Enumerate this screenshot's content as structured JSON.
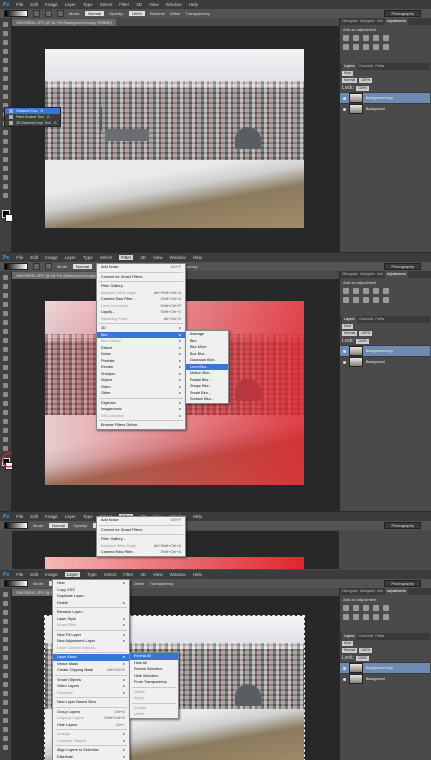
{
  "app": {
    "logo": "Ps",
    "menus": [
      "File",
      "Edit",
      "Image",
      "Layer",
      "Type",
      "Select",
      "Filter",
      "3D",
      "View",
      "Window",
      "Help"
    ],
    "workspace": "Photography"
  },
  "options_bar": {
    "mode_label": "Mode:",
    "mode_value": "Normal",
    "opacity_label": "Opacity:",
    "opacity_value": "100%",
    "reverse": "Reverse",
    "dither": "Dither",
    "transparency": "Transparency"
  },
  "document_tab": "ZNKS5931.JPG @ 16,7% (Background copy, RGB/8*)",
  "panels": {
    "tabs": [
      "Histogram",
      "Navigator",
      "Info",
      "Adjustments"
    ],
    "adjustments_title": "Add an adjustment",
    "layer_tabs": [
      "Layers",
      "Channels",
      "Paths"
    ],
    "kind_label": "Kind",
    "blend_mode": "Normal",
    "opacity_value": "100%",
    "lock_label": "Lock:",
    "fill_value": "100%",
    "layers": [
      {
        "name": "Background copy"
      },
      {
        "name": "Background"
      }
    ]
  },
  "tools_flyout": {
    "items": [
      {
        "label": "Gradient Tool",
        "key": "G",
        "highlighted": true
      },
      {
        "label": "Paint Bucket Tool",
        "key": "G",
        "highlighted": false
      },
      {
        "label": "3D Material Drop Tool",
        "key": "G",
        "highlighted": false
      }
    ]
  },
  "filter_menu": {
    "items": [
      {
        "label": "Add Noise",
        "shortcut": "Ctrl+F",
        "disabled": false
      },
      {
        "label": "Convert for Smart Filters",
        "shortcut": "",
        "disabled": false
      },
      {
        "label": "Filter Gallery...",
        "shortcut": "",
        "disabled": false
      },
      {
        "label": "Adaptive Wide Angle...",
        "shortcut": "Alt+Shift+Ctrl+A",
        "disabled": true
      },
      {
        "label": "Camera Raw Filter...",
        "shortcut": "Shift+Ctrl+A",
        "disabled": false
      },
      {
        "label": "Lens Correction...",
        "shortcut": "Shift+Ctrl+R",
        "disabled": true
      },
      {
        "label": "Liquify...",
        "shortcut": "Shift+Ctrl+X",
        "disabled": false
      },
      {
        "label": "Vanishing Point...",
        "shortcut": "Alt+Ctrl+V",
        "disabled": true
      },
      {
        "label": "3D",
        "shortcut": "",
        "disabled": false
      },
      {
        "label": "Blur",
        "shortcut": "",
        "disabled": false,
        "highlighted": true
      },
      {
        "label": "Blur Gallery",
        "shortcut": "",
        "disabled": true
      },
      {
        "label": "Distort",
        "shortcut": "",
        "disabled": false
      },
      {
        "label": "Noise",
        "shortcut": "",
        "disabled": false
      },
      {
        "label": "Pixelate",
        "shortcut": "",
        "disabled": false
      },
      {
        "label": "Render",
        "shortcut": "",
        "disabled": false
      },
      {
        "label": "Sharpen",
        "shortcut": "",
        "disabled": false
      },
      {
        "label": "Stylize",
        "shortcut": "",
        "disabled": false
      },
      {
        "label": "Video",
        "shortcut": "",
        "disabled": false
      },
      {
        "label": "Other",
        "shortcut": "",
        "disabled": false
      },
      {
        "label": "Digimarc",
        "shortcut": "",
        "disabled": false
      },
      {
        "label": "Imagenomic",
        "shortcut": "",
        "disabled": false
      },
      {
        "label": "Nik Collection",
        "shortcut": "",
        "disabled": true
      },
      {
        "label": "Browse Filters Online...",
        "shortcut": "",
        "disabled": false
      }
    ]
  },
  "blur_submenu": {
    "items": [
      {
        "label": "Average",
        "highlighted": false
      },
      {
        "label": "Blur",
        "highlighted": false
      },
      {
        "label": "Blur More",
        "highlighted": false
      },
      {
        "label": "Box Blur...",
        "highlighted": false
      },
      {
        "label": "Gaussian Blur...",
        "highlighted": false
      },
      {
        "label": "Lens Blur...",
        "highlighted": true
      },
      {
        "label": "Motion Blur...",
        "highlighted": false
      },
      {
        "label": "Radial Blur...",
        "highlighted": false
      },
      {
        "label": "Shape Blur...",
        "highlighted": false
      },
      {
        "label": "Smart Blur...",
        "highlighted": false
      },
      {
        "label": "Surface Blur...",
        "highlighted": false
      }
    ]
  },
  "filter_menu_short": {
    "items": [
      {
        "label": "Add Noise",
        "shortcut": "Ctrl+F"
      },
      {
        "label": "Convert for Smart Filters",
        "shortcut": ""
      },
      {
        "label": "Filter Gallery...",
        "shortcut": ""
      },
      {
        "label": "Adaptive Wide Angle...",
        "shortcut": "Alt+Shift+Ctrl+A"
      },
      {
        "label": "Camera Raw Filter...",
        "shortcut": "Shift+Ctrl+A"
      },
      {
        "label": "Lens Correction...",
        "shortcut": "Shift+Ctrl+R"
      },
      {
        "label": "Liquify...",
        "shortcut": "Shift+Ctrl+X"
      },
      {
        "label": "Vanishing Point...",
        "shortcut": "Alt+Ctrl+V"
      }
    ]
  },
  "layer_menu": {
    "items": [
      {
        "label": "New",
        "shortcut": "",
        "disabled": false
      },
      {
        "label": "Copy CSS",
        "shortcut": "",
        "disabled": false
      },
      {
        "label": "Duplicate Layer...",
        "shortcut": "",
        "disabled": false
      },
      {
        "label": "Delete",
        "shortcut": "",
        "disabled": false
      },
      {
        "label": "Rename Layer...",
        "shortcut": "",
        "disabled": false
      },
      {
        "label": "Layer Style",
        "shortcut": "",
        "disabled": false
      },
      {
        "label": "Smart Filter",
        "shortcut": "",
        "disabled": true
      },
      {
        "label": "New Fill Layer",
        "shortcut": "",
        "disabled": false
      },
      {
        "label": "New Adjustment Layer",
        "shortcut": "",
        "disabled": false
      },
      {
        "label": "Layer Content Options...",
        "shortcut": "",
        "disabled": true
      },
      {
        "label": "Layer Mask",
        "shortcut": "",
        "disabled": false,
        "highlighted": true
      },
      {
        "label": "Vector Mask",
        "shortcut": "",
        "disabled": false
      },
      {
        "label": "Create Clipping Mask",
        "shortcut": "Alt+Ctrl+G",
        "disabled": false
      },
      {
        "label": "Smart Objects",
        "shortcut": "",
        "disabled": false
      },
      {
        "label": "Video Layers",
        "shortcut": "",
        "disabled": false
      },
      {
        "label": "Rasterize",
        "shortcut": "",
        "disabled": true
      },
      {
        "label": "New Layer Based Slice",
        "shortcut": "",
        "disabled": false
      },
      {
        "label": "Group Layers",
        "shortcut": "Ctrl+G",
        "disabled": false
      },
      {
        "label": "Ungroup Layers",
        "shortcut": "Shift+Ctrl+G",
        "disabled": true
      },
      {
        "label": "Hide Layers",
        "shortcut": "Ctrl+,",
        "disabled": false
      },
      {
        "label": "Arrange",
        "shortcut": "",
        "disabled": true
      },
      {
        "label": "Combine Shapes",
        "shortcut": "",
        "disabled": true
      },
      {
        "label": "Align Layers to Selection",
        "shortcut": "",
        "disabled": false
      },
      {
        "label": "Distribute",
        "shortcut": "",
        "disabled": false
      }
    ]
  },
  "layer_mask_submenu": {
    "items": [
      {
        "label": "Reveal All",
        "highlighted": true,
        "disabled": false
      },
      {
        "label": "Hide All",
        "highlighted": false,
        "disabled": false
      },
      {
        "label": "Reveal Selection",
        "highlighted": false,
        "disabled": false
      },
      {
        "label": "Hide Selection",
        "highlighted": false,
        "disabled": false
      },
      {
        "label": "From Transparency",
        "highlighted": false,
        "disabled": false
      },
      {
        "label": "Delete",
        "highlighted": false,
        "disabled": true
      },
      {
        "label": "Apply",
        "highlighted": false,
        "disabled": true
      },
      {
        "label": "Enable",
        "highlighted": false,
        "disabled": true
      },
      {
        "label": "Unlink",
        "highlighted": false,
        "disabled": true
      }
    ]
  },
  "colors": {
    "accent": "#3875d7",
    "red_tint": "#e0262e",
    "arrow": "#e11d2a"
  }
}
